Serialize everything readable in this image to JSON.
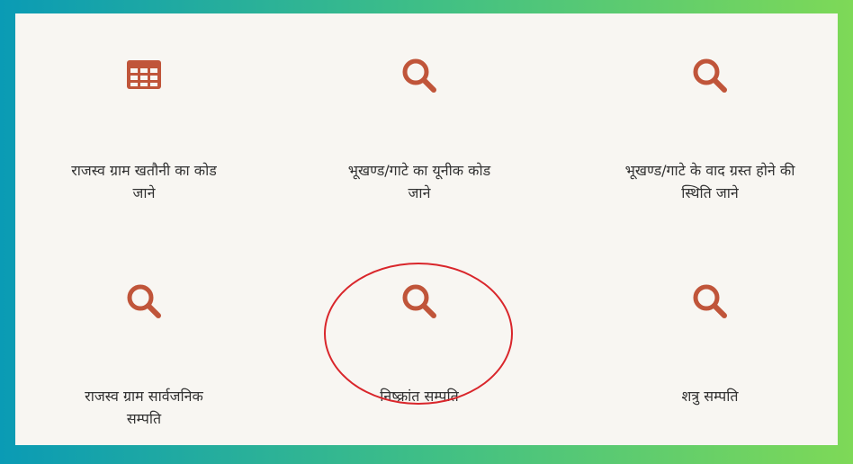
{
  "accent_color": "#c0553a",
  "annotation_color": "#d9262b",
  "tiles": [
    {
      "label": "राजस्व ग्राम खतौनी का कोड जाने",
      "icon": "table-icon"
    },
    {
      "label": "भूखण्ड/गाटे का यूनीक कोड जाने",
      "icon": "search-icon"
    },
    {
      "label": "भूखण्ड/गाटे के वाद ग्रस्त होने की स्थिति जाने",
      "icon": "search-icon"
    },
    {
      "label": "राजस्व ग्राम सार्वजनिक सम्पति",
      "icon": "search-icon"
    },
    {
      "label": "निष्क्रांत सम्पति",
      "icon": "search-icon"
    },
    {
      "label": "शत्रु सम्पति",
      "icon": "search-icon"
    }
  ]
}
